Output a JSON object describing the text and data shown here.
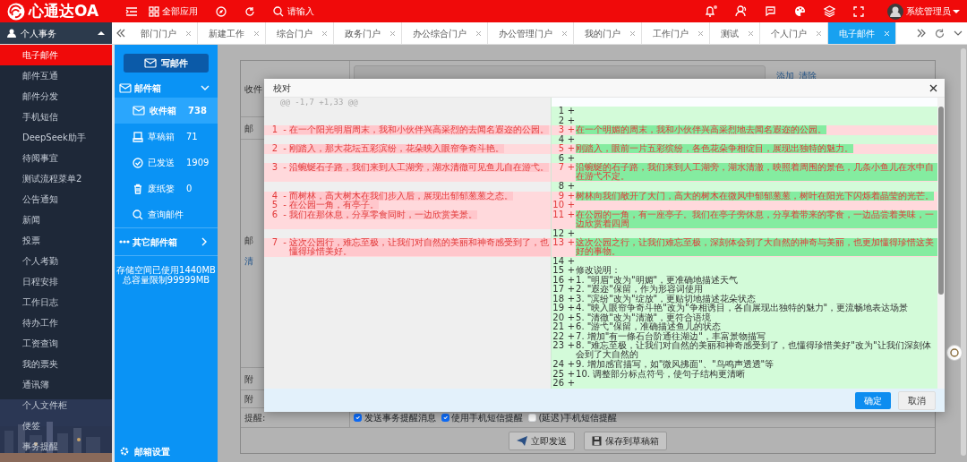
{
  "topbar": {
    "logo": "心通达OA",
    "apps_label": "全部应用",
    "search": {
      "placeholder": "请输入"
    },
    "notification_dot": true,
    "user": "系统管理员"
  },
  "sidebar": {
    "title": "个人事务",
    "expanded": true,
    "items": [
      {
        "label": "电子邮件",
        "selected": true
      },
      {
        "label": "邮件互通",
        "selected": false
      },
      {
        "label": "邮件分发",
        "selected": false
      },
      {
        "label": "手机短信",
        "selected": false
      },
      {
        "label": "DeepSeek助手",
        "selected": false
      },
      {
        "label": "待阅事宜",
        "selected": false
      },
      {
        "label": "测试流程菜单2",
        "selected": false
      },
      {
        "label": "公告通知",
        "selected": false
      },
      {
        "label": "新闻",
        "selected": false
      },
      {
        "label": "投票",
        "selected": false
      },
      {
        "label": "个人考勤",
        "selected": false
      },
      {
        "label": "日程安排",
        "selected": false
      },
      {
        "label": "工作日志",
        "selected": false
      },
      {
        "label": "待办工作",
        "selected": false
      },
      {
        "label": "工资查询",
        "selected": false
      },
      {
        "label": "我的票夹",
        "selected": false
      },
      {
        "label": "通讯簿",
        "selected": false
      },
      {
        "label": "个人文件柜",
        "selected": false
      },
      {
        "label": "便签",
        "selected": false
      },
      {
        "label": "事务提醒",
        "selected": false
      }
    ]
  },
  "tabs": [
    {
      "label": "部门门户",
      "selected": false
    },
    {
      "label": "新建工作",
      "selected": false
    },
    {
      "label": "综合门户",
      "selected": false
    },
    {
      "label": "政务门户",
      "selected": false
    },
    {
      "label": "办公综合门户",
      "selected": false
    },
    {
      "label": "办公管理门户",
      "selected": false
    },
    {
      "label": "我的门户",
      "selected": false
    },
    {
      "label": "工作门户",
      "selected": false
    },
    {
      "label": "测试",
      "selected": false
    },
    {
      "label": "个人门户",
      "selected": false
    },
    {
      "label": "电子邮件",
      "selected": true
    }
  ],
  "mail_panel": {
    "compose": "写邮件",
    "mailbox_title": "邮件箱",
    "folders": [
      {
        "kind": "inbox",
        "name": "收件箱",
        "count": "738",
        "selected": true
      },
      {
        "kind": "drafts",
        "name": "草稿箱",
        "count": "71",
        "selected": false
      },
      {
        "kind": "sent",
        "name": "已发送",
        "count": "1909",
        "selected": false
      },
      {
        "kind": "trash",
        "name": "废纸篓",
        "count": "0",
        "selected": false
      },
      {
        "kind": "search",
        "name": "查询邮件",
        "selected": false
      }
    ],
    "other_mailboxes": "其它邮件箱",
    "storage": [
      "存储空间已使用1440MB",
      "总容量限制99999MB"
    ],
    "settings": "邮箱设置"
  },
  "form": {
    "links": [
      "添加",
      "清除"
    ],
    "rows": [
      {
        "label": "收件"
      },
      {
        "label": "邮"
      },
      {
        "label": "邮",
        "link": "清"
      },
      {
        "label": "附"
      },
      {
        "label": "附"
      },
      {
        "label": "提醒:"
      }
    ],
    "options": [
      {
        "label": "发送事务提醒消息",
        "checked": true
      },
      {
        "label": "使用手机短信提醒",
        "checked": true
      },
      {
        "label": "(延迟)手机短信提醒",
        "checked": false
      }
    ],
    "buttons": [
      {
        "kind": "send",
        "label": "立即发送"
      },
      {
        "kind": "save",
        "label": "保存到草稿箱"
      }
    ]
  },
  "dialog": {
    "title": "校对",
    "hunk": "@@ -1,7 +1,33 @@",
    "rows": [
      {
        "right": {
          "num": "1",
          "sign": "+",
          "changed": false
        }
      },
      {
        "right": {
          "num": "2",
          "sign": "+",
          "changed": false
        }
      },
      {
        "left": {
          "num": "1",
          "sign": "-",
          "text": "在一个阳光明眉周末，我和小伙伴兴高采烈的去闻名遐迩的公园。"
        },
        "right": {
          "num": "3",
          "sign": "+",
          "text": "在一个明媚的周末，我和小伙伴兴高采烈地去闻名遐迩的公园。",
          "changed": true
        }
      },
      {
        "right": {
          "num": "4",
          "sign": "+",
          "changed": false
        }
      },
      {
        "left": {
          "num": "2",
          "sign": "-",
          "text": "刚踏入，那大花坛五彩滨纷，花朵映入眼帘争奇斗艳。"
        },
        "right": {
          "num": "5",
          "sign": "+",
          "text": "刚踏入，眼前一片五彩缤纷，各色花朵争相绽目，展现出独特的魅力。",
          "changed": true
        }
      },
      {
        "right": {
          "num": "6",
          "sign": "+",
          "changed": false
        }
      },
      {
        "left": {
          "num": "3",
          "sign": "-",
          "text": "沿蜿蜒石子路，我们来到人工湖旁，湖水清徹可见鱼儿自在游弋。"
        },
        "right": {
          "num": "7",
          "sign": "+",
          "text": "沿蜿蜒的石子路，我们来到人工湖旁，湖水清澈，映照着周围的景色，几条小鱼儿在水中自在游弋不定。",
          "changed": true
        }
      },
      {
        "right": {
          "num": "8",
          "sign": "+",
          "changed": false
        }
      },
      {
        "left": {
          "num": "4",
          "sign": "-",
          "text": "而树林，高大树木在我们步入后，展现出郁郁葱葱之态。"
        },
        "right": {
          "num": "9",
          "sign": "+",
          "text": "树林向我们敞开了大门，高大的树木在微风中郁郁葱葱，树叶在阳光下闪烁着晶莹的光芒。",
          "changed": true
        }
      },
      {
        "left": {
          "num": "5",
          "sign": "-",
          "text": "在公园一角，有亭子。"
        },
        "right": {
          "num": "10",
          "sign": "+",
          "changed": true
        }
      },
      {
        "left": {
          "num": "6",
          "sign": "-",
          "text": "我们在那休息，分享零食同时，一边欣赏美景。"
        },
        "right": {
          "num": "11",
          "sign": "+",
          "text": "在公园的一角，有一座亭子。我们在亭子旁休息，分享着带来的零食，一边品尝着美味，一边欣赏着四周",
          "changed": true
        }
      },
      {
        "right": {
          "num": "12",
          "sign": "+",
          "changed": false
        }
      },
      {
        "left": {
          "num": "7",
          "sign": "-",
          "text": "这次公园行，难忘至极，让我们对自然的美丽和神奇感受到了，也懂得珍惜美好。"
        },
        "right": {
          "num": "13",
          "sign": "+",
          "text": "这次公园之行，让我们难忘至极，深刻体会到了大自然的神奇与美丽，也更加懂得珍惜这美好的事物。",
          "changed": true
        }
      },
      {
        "right": {
          "num": "14",
          "sign": "+",
          "changed": false
        }
      },
      {
        "right": {
          "num": "15",
          "sign": "+",
          "text": "修改说明：",
          "changed": false
        }
      },
      {
        "right": {
          "num": "16",
          "sign": "+",
          "text": "1. \"明眉\"改为\"明媚\"，更准确地描述天气",
          "changed": false
        }
      },
      {
        "right": {
          "num": "17",
          "sign": "+",
          "text": "2. \"遐迩\"保留，作为形容词使用",
          "changed": false
        }
      },
      {
        "right": {
          "num": "18",
          "sign": "+",
          "text": "3. \"滨纷\"改为\"绽放\"，更贴切地描述花朵状态",
          "changed": false
        }
      },
      {
        "right": {
          "num": "19",
          "sign": "+",
          "text": "4. \"映入眼帘争奇斗艳\"改为\"争相诱目，各自展现出独特的魅力\"，更流畅地表达场景",
          "changed": false
        }
      },
      {
        "right": {
          "num": "20",
          "sign": "+",
          "text": "5. \"清徹\"改为\"清澈\"，更符合语境",
          "changed": false
        }
      },
      {
        "right": {
          "num": "21",
          "sign": "+",
          "text": "6. \"游弋\"保留，准确描述鱼儿的状态",
          "changed": false
        }
      },
      {
        "right": {
          "num": "22",
          "sign": "+",
          "text": "7. 增加\"有一條石台阶通往湖边\"，丰富景物描写",
          "changed": false
        }
      },
      {
        "right": {
          "num": "23",
          "sign": "+",
          "text": "8. \"难忘至极，让我们对自然的美丽和神奇感受到了，也懂得珍惜美好\"改为\"让我们深刻体会到了大自然的",
          "changed": false
        }
      },
      {
        "right": {
          "num": "24",
          "sign": "+",
          "text": "9. 增加感官描写，如\"微风拂面\"、\"鸟鸣声透透\"等",
          "changed": false
        }
      },
      {
        "right": {
          "num": "25",
          "sign": "+",
          "text": "10. 调整部分标点符号，使句子结构更清晰",
          "changed": false
        }
      },
      {
        "right": {
          "num": "26",
          "sign": "+",
          "changed": false
        }
      }
    ],
    "buttons": [
      {
        "kind": "primary",
        "label": "确定"
      },
      {
        "kind": "secondary",
        "label": "取消"
      }
    ]
  }
}
